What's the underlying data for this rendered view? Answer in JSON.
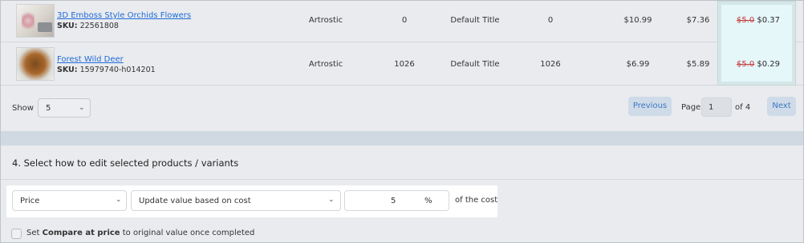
{
  "products": [
    {
      "name": "3D Emboss Style Orchids Flowers",
      "sku_label": "SKU:",
      "sku": "22561808",
      "vendor": "Artrostic",
      "inventory": "0",
      "variant": "Default Title",
      "quantity": "0",
      "price": "$10.99",
      "cost": "$7.36",
      "old_value": "$5.0",
      "new_value": "$0.37"
    },
    {
      "name": "Forest Wild Deer",
      "sku_label": "SKU:",
      "sku": "15979740-h014201",
      "vendor": "Artrostic",
      "inventory": "1026",
      "variant": "Default Title",
      "quantity": "1026",
      "price": "$6.99",
      "cost": "$5.89",
      "old_value": "$5.0",
      "new_value": "$0.29"
    }
  ],
  "pagination": {
    "show_label": "Show",
    "show_value": "5",
    "previous_label": "Previous",
    "page_label": "Page",
    "page_value": "1",
    "of_label": "of 4",
    "next_label": "Next"
  },
  "section4": {
    "title": "4. Select how to edit selected products / variants",
    "field_select": "Price",
    "method_select": "Update value based on cost",
    "amount_value": "5",
    "amount_unit": "%",
    "suffix": "of the cost",
    "checkbox_prefix": "Set ",
    "checkbox_bold": "Compare at price",
    "checkbox_suffix": " to original value once completed"
  },
  "colors": {
    "link": "#1f6ad8",
    "strike": "#c43a3a",
    "highlight": "#e6f7fa",
    "button": "#cfdbe8"
  },
  "icons": {
    "select_chevron": "chevron-down-icon"
  }
}
